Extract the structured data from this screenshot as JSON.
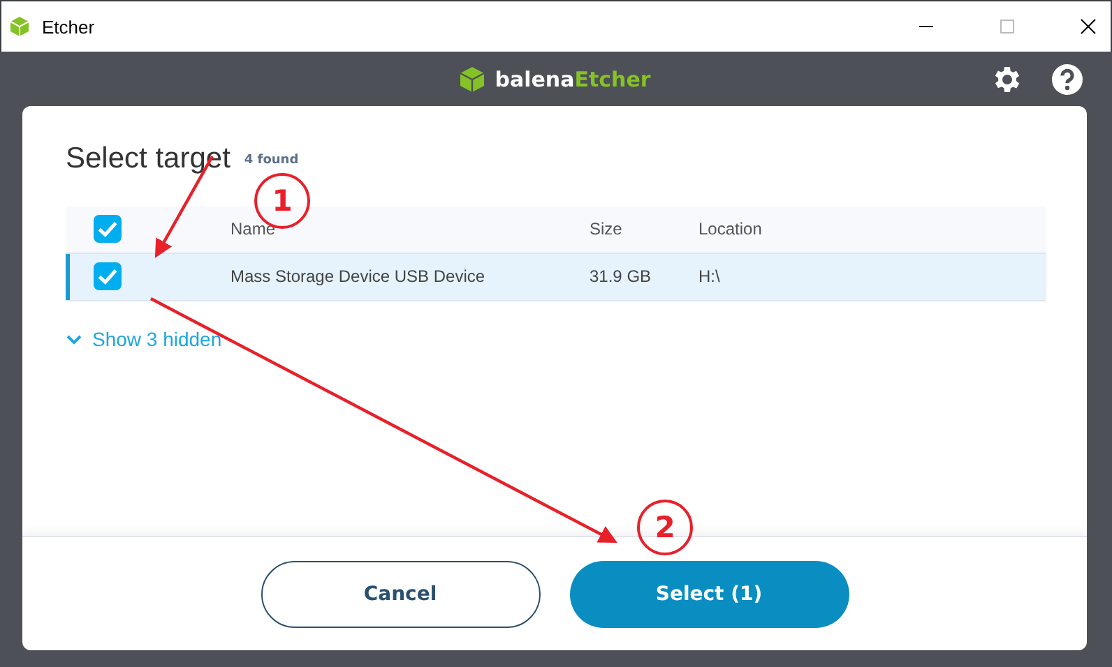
{
  "window": {
    "title": "Etcher"
  },
  "brand": {
    "prefix": "balena",
    "name": "Etcher"
  },
  "modal": {
    "title": "Select target",
    "count": "4 found",
    "table": {
      "select_all_checked": true,
      "columns": [
        "Name",
        "Size",
        "Location"
      ],
      "rows": [
        {
          "name": "Mass Storage Device USB Device",
          "size": "31.9 GB",
          "location": "H:\\",
          "checked": true,
          "selected": true
        }
      ]
    },
    "show_hidden": {
      "label": "Show 3 hidden",
      "expanded": false
    },
    "buttons": [
      {
        "label": "Cancel",
        "kind": "secondary"
      },
      {
        "label": "Select (1)",
        "kind": "primary"
      }
    ]
  },
  "annotations": [
    {
      "label": "1"
    },
    {
      "label": "2"
    }
  ]
}
